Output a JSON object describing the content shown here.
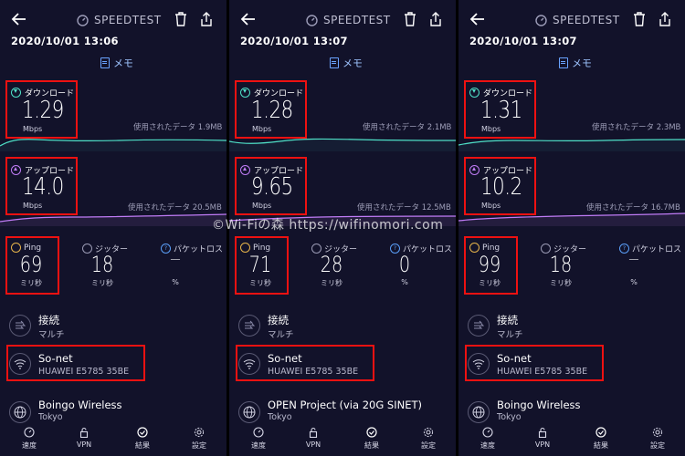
{
  "watermark": "©Wi-Fiの森 https://wifinomori.com",
  "colors": {
    "background": "#12122a",
    "accent_download": "#4fe0c7",
    "accent_upload": "#c07cf6",
    "highlight_box": "#e11111",
    "link": "#9ec4ff"
  },
  "common": {
    "brand": "SPEEDTEST",
    "memo": "メモ",
    "download_label": "ダウンロード",
    "upload_label": "アップロード",
    "speed_unit": "Mbps",
    "ping_label": "Ping",
    "jitter_label": "ジッター",
    "loss_label": "パケットロス",
    "ms_unit": "ミリ秒",
    "percent_unit": "%",
    "connection_title": "接続",
    "connection_type": "マルチ",
    "tabs": [
      "速度",
      "VPN",
      "結果",
      "設定"
    ]
  },
  "panels": [
    {
      "datetime": "2020/10/01 13:06",
      "download": "1.29",
      "download_used": "使用されたデータ 1.9MB",
      "upload": "14.0",
      "upload_used": "使用されたデータ 20.5MB",
      "ping": "69",
      "jitter": "18",
      "loss": "—",
      "provider": "So-net",
      "device": "HUAWEI  E5785  35BE",
      "server": "Boingo Wireless",
      "server_location": "Tokyo"
    },
    {
      "datetime": "2020/10/01 13:07",
      "download": "1.28",
      "download_used": "使用されたデータ 2.1MB",
      "upload": "9.65",
      "upload_used": "使用されたデータ 12.5MB",
      "ping": "71",
      "jitter": "28",
      "loss": "0",
      "provider": "So-net",
      "device": "HUAWEI  E5785  35BE",
      "server": "OPEN Project (via 20G SINET)",
      "server_location": "Tokyo"
    },
    {
      "datetime": "2020/10/01 13:07",
      "download": "1.31",
      "download_used": "使用されたデータ 2.3MB",
      "upload": "10.2",
      "upload_used": "使用されたデータ 16.7MB",
      "ping": "99",
      "jitter": "18",
      "loss": "—",
      "provider": "So-net",
      "device": "HUAWEI  E5785  35BE",
      "server": "Boingo Wireless",
      "server_location": "Tokyo"
    }
  ]
}
